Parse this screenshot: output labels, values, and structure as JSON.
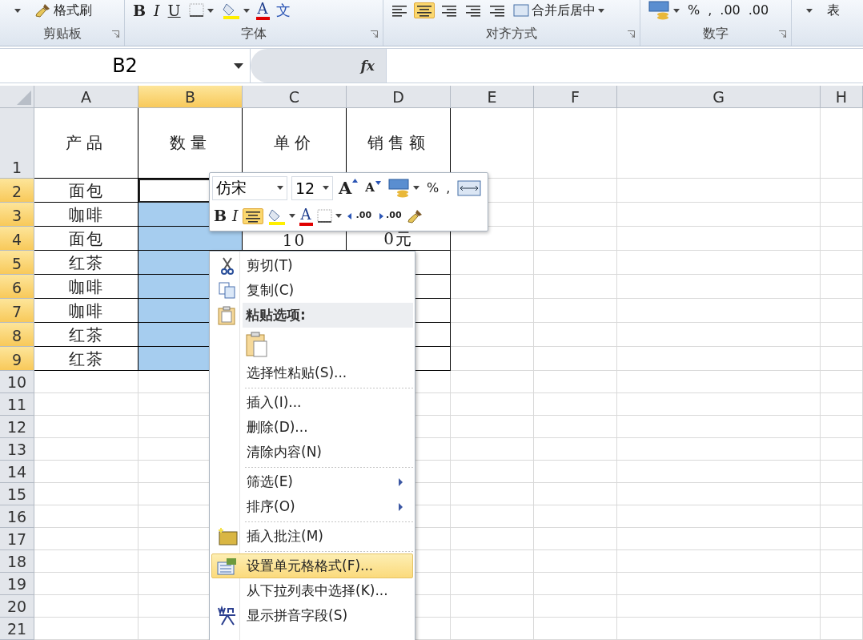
{
  "ribbon": {
    "groups": [
      {
        "label": "剪贴板",
        "items": [
          {
            "kind": "dropdown"
          },
          {
            "kind": "format-painter",
            "text": "格式刷"
          }
        ]
      },
      {
        "label": "字体",
        "items": [
          {
            "kind": "bold",
            "text": "B"
          },
          {
            "kind": "italic",
            "text": "I"
          },
          {
            "kind": "underline",
            "text": "U"
          },
          {
            "kind": "borders"
          },
          {
            "kind": "fill-color"
          },
          {
            "kind": "font-color",
            "text": "A"
          },
          {
            "kind": "phonetic",
            "text": "文"
          }
        ]
      },
      {
        "label": "对齐方式",
        "items": [
          {
            "kind": "align-left",
            "selected": false
          },
          {
            "kind": "align-center",
            "selected": true
          },
          {
            "kind": "align-right",
            "selected": false
          },
          {
            "kind": "indent"
          },
          {
            "kind": "indent"
          },
          {
            "kind": "merge",
            "text": "合并后居中"
          }
        ]
      },
      {
        "label": "数字",
        "items": [
          {
            "kind": "accounting"
          },
          {
            "kind": "plain",
            "text": "%"
          },
          {
            "kind": "plain",
            "text": ","
          },
          {
            "kind": "plain",
            "text": ".00"
          },
          {
            "kind": "plain",
            "text": ".00"
          }
        ]
      },
      {
        "items": [
          {
            "kind": "dropdown"
          },
          {
            "kind": "plain",
            "text": "表"
          }
        ]
      }
    ]
  },
  "formula_bar": {
    "name_box": "B2",
    "function_label": "fx"
  },
  "columns": [
    {
      "label": "A",
      "selected": false
    },
    {
      "label": "B",
      "selected": true
    },
    {
      "label": "C",
      "selected": false
    },
    {
      "label": "D",
      "selected": false
    },
    {
      "label": "E",
      "selected": false
    },
    {
      "label": "F",
      "selected": false
    },
    {
      "label": "G",
      "selected": false
    },
    {
      "label": "H",
      "selected": false
    }
  ],
  "rows": [
    {
      "label": "1",
      "selected": false,
      "cells": [
        {
          "text": "产品"
        },
        {
          "text": "数量"
        },
        {
          "text": "单价"
        },
        {
          "text": "销售额"
        }
      ]
    },
    {
      "label": "2",
      "selected": true,
      "cells": [
        {
          "text": "面包"
        },
        {
          "active": true
        }
      ]
    },
    {
      "label": "3",
      "selected": true,
      "cells": [
        {
          "text": "咖啡"
        },
        {
          "selected": true
        }
      ]
    },
    {
      "label": "4",
      "selected": true,
      "cells": [
        {
          "text": "面包"
        },
        {
          "selected": true
        },
        {
          "text": "10"
        },
        {
          "text": "0元"
        }
      ]
    },
    {
      "label": "5",
      "selected": true,
      "cells": [
        {
          "text": "红茶"
        },
        {
          "selected": true
        }
      ]
    },
    {
      "label": "6",
      "selected": true,
      "cells": [
        {
          "text": "咖啡"
        },
        {
          "selected": true
        }
      ]
    },
    {
      "label": "7",
      "selected": true,
      "cells": [
        {
          "text": "咖啡"
        },
        {
          "selected": true
        }
      ]
    },
    {
      "label": "8",
      "selected": true,
      "cells": [
        {
          "text": "红茶"
        },
        {
          "selected": true
        }
      ]
    },
    {
      "label": "9",
      "selected": true,
      "cells": [
        {
          "text": "红茶"
        },
        {
          "selected": true
        }
      ]
    },
    {
      "label": "10",
      "selected": false
    },
    {
      "label": "11",
      "selected": false
    },
    {
      "label": "12",
      "selected": false
    },
    {
      "label": "13",
      "selected": false
    },
    {
      "label": "14",
      "selected": false
    },
    {
      "label": "15",
      "selected": false
    },
    {
      "label": "16",
      "selected": false
    },
    {
      "label": "17",
      "selected": false
    },
    {
      "label": "18",
      "selected": false
    },
    {
      "label": "19",
      "selected": false
    },
    {
      "label": "20",
      "selected": false
    },
    {
      "label": "21",
      "selected": false
    }
  ],
  "mini_toolbar": {
    "font": "仿宋",
    "size": "12",
    "row1": [
      {
        "kind": "grow-font",
        "text": "A"
      },
      {
        "kind": "shrink-font",
        "text": "A"
      },
      {
        "kind": "accounting"
      },
      {
        "kind": "plain",
        "text": "%"
      },
      {
        "kind": "plain",
        "text": ","
      },
      {
        "kind": "wrap"
      }
    ],
    "row2": [
      {
        "kind": "bold",
        "text": "B"
      },
      {
        "kind": "italic",
        "text": "I"
      },
      {
        "kind": "align-center",
        "selected": true
      },
      {
        "kind": "fill-color"
      },
      {
        "kind": "font-color",
        "text": "A"
      },
      {
        "kind": "borders"
      },
      {
        "kind": "increase-decimal",
        "text": ".00"
      },
      {
        "kind": "decrease-decimal",
        "text": ".00"
      },
      {
        "kind": "format-painter"
      }
    ]
  },
  "context_menu": [
    {
      "kind": "cut",
      "text": "剪切(T)",
      "highlighted": false,
      "divider_after": false
    },
    {
      "kind": "copy",
      "text": "复制(C)",
      "highlighted": false,
      "divider_after": false
    },
    {
      "kind": "paste-header",
      "text": "粘贴选项:",
      "highlighted": false,
      "divider_after": false
    },
    {
      "kind": "paste-option",
      "highlighted": false,
      "divider_after": false
    },
    {
      "kind": "plain",
      "text": "选择性粘贴(S)...",
      "highlighted": false,
      "divider_after": true
    },
    {
      "kind": "plain",
      "text": "插入(I)...",
      "highlighted": false,
      "divider_after": false
    },
    {
      "kind": "plain",
      "text": "删除(D)...",
      "highlighted": false,
      "divider_after": false
    },
    {
      "kind": "plain",
      "text": "清除内容(N)",
      "highlighted": false,
      "divider_after": true
    },
    {
      "kind": "submenu",
      "text": "筛选(E)",
      "highlighted": false,
      "divider_after": false
    },
    {
      "kind": "submenu",
      "text": "排序(O)",
      "highlighted": false,
      "divider_after": true
    },
    {
      "kind": "comment",
      "text": "插入批注(M)",
      "highlighted": false,
      "divider_after": true
    },
    {
      "kind": "format",
      "text": "设置单元格格式(F)...",
      "highlighted": true,
      "divider_after": false
    },
    {
      "kind": "plain",
      "text": "从下拉列表中选择(K)...",
      "highlighted": false,
      "divider_after": false
    },
    {
      "kind": "phonetic",
      "text": "显示拼音字段(S)",
      "highlighted": false,
      "divider_after": false
    }
  ]
}
